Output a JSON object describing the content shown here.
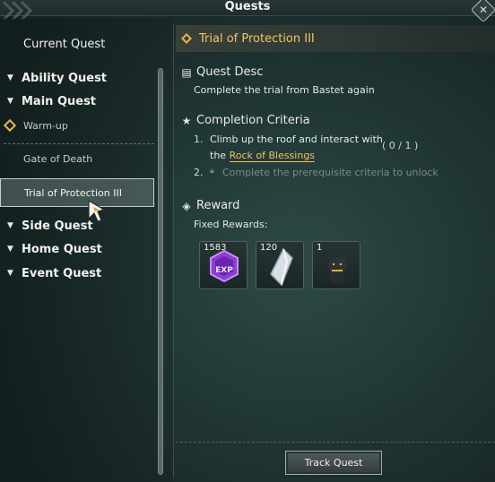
{
  "window": {
    "title": "Quests"
  },
  "sidebar": {
    "current_quest_label": "Current Quest",
    "categories": {
      "ability": "Ability Quest",
      "main": "Main Quest",
      "side": "Side Quest",
      "home": "Home Quest",
      "event": "Event Quest"
    },
    "main_items": [
      "Warm-up",
      "Gate of Death",
      "Trial of Protection III"
    ]
  },
  "quest": {
    "title": "Trial of Protection III",
    "desc_header": "Quest Desc",
    "desc_text": "Complete the trial from Bastet again",
    "criteria_header": "Completion Criteria",
    "criteria": [
      {
        "num": "1.",
        "line1": "Climb up the roof and interact with",
        "line2_prefix": "the ",
        "link": "Rock of Blessings",
        "progress": "( 0 / 1 )"
      },
      {
        "num": "2.",
        "text": "Complete the prerequisite criteria to unlock"
      }
    ],
    "reward_header": "Reward",
    "fixed_rewards_label": "Fixed Rewards:",
    "rewards": [
      {
        "count": "1583",
        "icon": "exp-icon"
      },
      {
        "count": "120",
        "icon": "crystal-icon"
      },
      {
        "count": "1",
        "icon": "cat-figure-icon"
      }
    ],
    "track_button": "Track Quest"
  },
  "colors": {
    "accent": "#f1c25c",
    "background": "#223a38"
  }
}
